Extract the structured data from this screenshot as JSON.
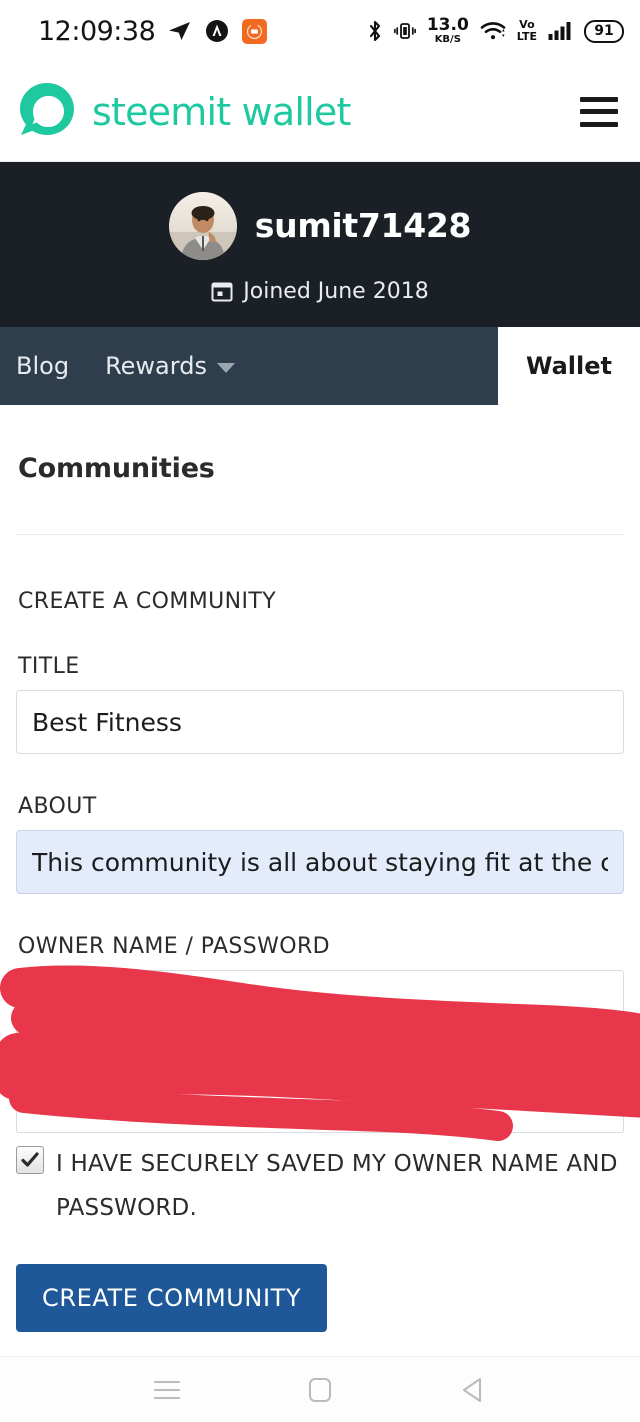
{
  "statusbar": {
    "clock": "12:09:38",
    "icons_left": [
      "telegram-icon",
      "autodesk-icon",
      "mi-app-icon"
    ],
    "network_speed_value": "13.0",
    "network_speed_unit": "KB/S",
    "volte_top": "Vo",
    "volte_bottom": "LTE",
    "battery_percent": "91",
    "icons_right": [
      "bluetooth-icon",
      "vibrate-icon",
      "wifi-icon",
      "volte-icon",
      "signal-icon",
      "battery-icon"
    ]
  },
  "header": {
    "brand": "steemit wallet",
    "logo_icon": "steemit-logo-icon",
    "menu_icon": "hamburger-menu-icon"
  },
  "profile": {
    "username": "sumit71428",
    "joined": "Joined June 2018",
    "calendar_icon": "calendar-icon",
    "avatar_icon": "user-avatar"
  },
  "tabs": [
    {
      "label": "Blog",
      "active": false,
      "has_caret": false
    },
    {
      "label": "Rewards",
      "active": false,
      "has_caret": true
    },
    {
      "label": "Wallet",
      "active": true,
      "has_caret": false
    }
  ],
  "main": {
    "section_title": "Communities",
    "form_heading": "CREATE A COMMUNITY",
    "fields": {
      "title": {
        "label": "TITLE",
        "value": "Best Fitness",
        "placeholder": "Title"
      },
      "about": {
        "label": "ABOUT",
        "value": "This community is all about staying fit at the c",
        "placeholder": "About"
      },
      "owner": {
        "label": "OWNER NAME / PASSWORD",
        "value": "",
        "placeholder": "",
        "redacted": true
      }
    },
    "checkbox": {
      "label": "I HAVE SECURELY SAVED MY OWNER NAME AND PASSWORD.",
      "checked": true
    },
    "submit_label": "CREATE COMMUNITY"
  },
  "androidnav": {
    "recents_icon": "recents-icon",
    "home_icon": "home-icon",
    "back_icon": "back-icon"
  },
  "colors": {
    "brand_teal": "#1fc9a0",
    "hero_dark": "#1b2026",
    "tabbar_dark": "#2f3e4d",
    "primary_blue": "#1f5899",
    "redaction_red": "#e8374b",
    "autofill_blue": "#e4ecfb"
  }
}
